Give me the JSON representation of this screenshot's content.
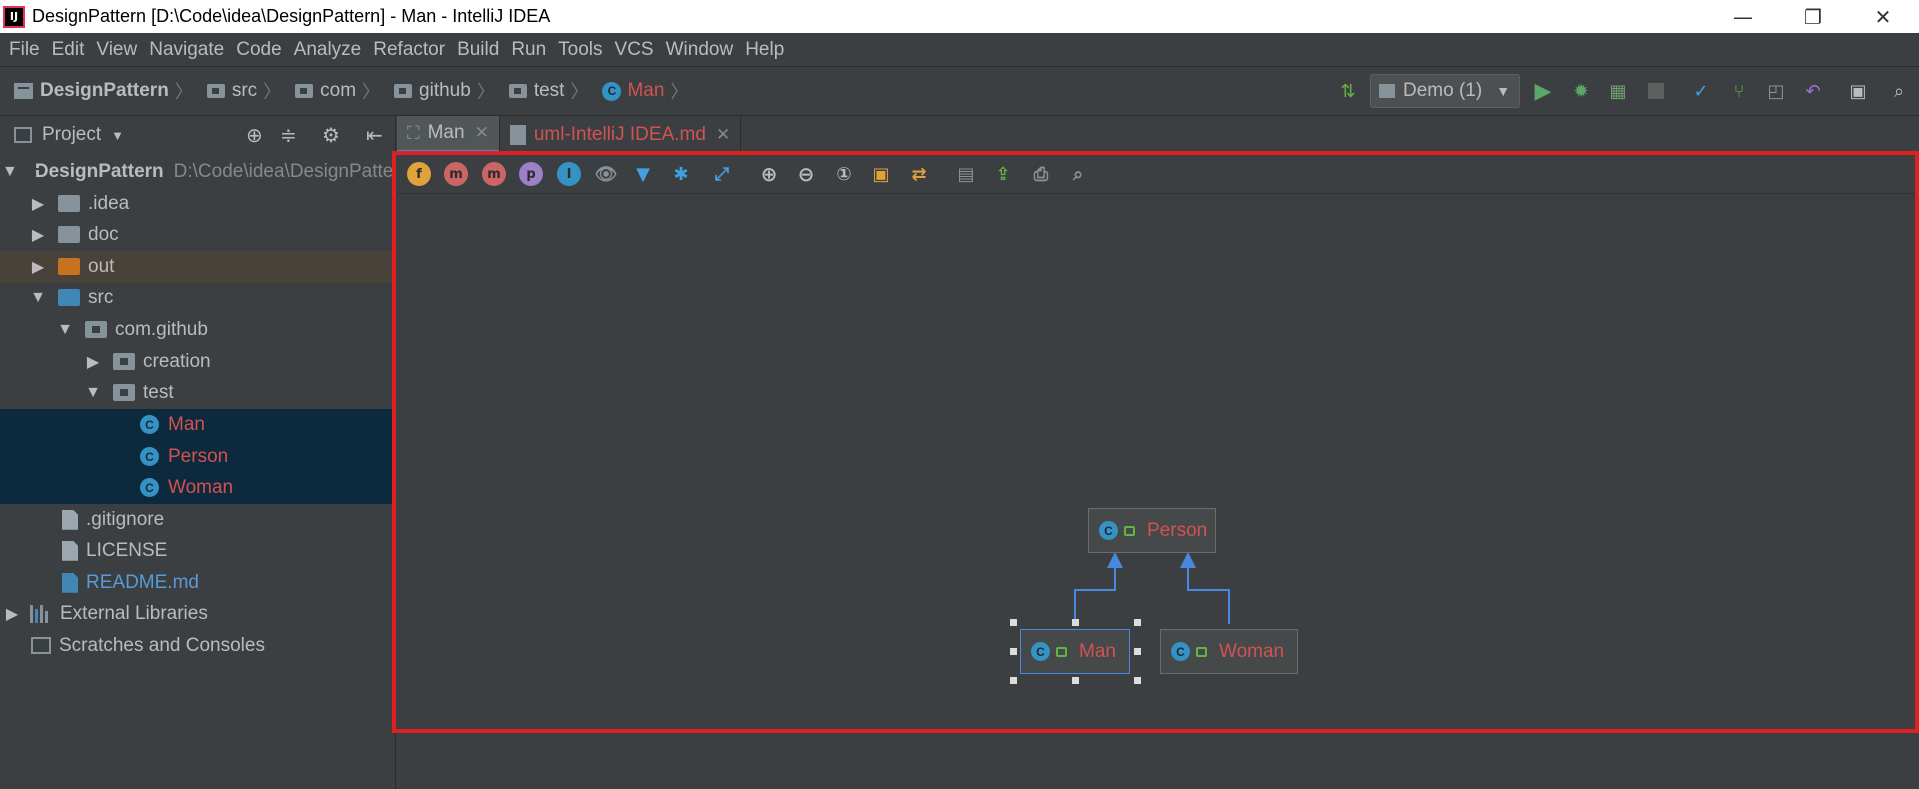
{
  "window": {
    "title": "DesignPattern [D:\\Code\\idea\\DesignPattern] - Man - IntelliJ IDEA",
    "logo_text": "IJ",
    "controls": {
      "minimize": "—",
      "restore": "❐",
      "close": "✕"
    }
  },
  "menu": {
    "items": [
      "File",
      "Edit",
      "View",
      "Navigate",
      "Code",
      "Analyze",
      "Refactor",
      "Build",
      "Run",
      "Tools",
      "VCS",
      "Window",
      "Help"
    ]
  },
  "breadcrumb": {
    "project": "DesignPattern",
    "items": [
      "src",
      "com",
      "github",
      "test"
    ],
    "current": "Man"
  },
  "run_config": {
    "label": "Demo (1)"
  },
  "project_panel": {
    "title": "Project",
    "tree": [
      {
        "label": "DesignPattern",
        "path": "D:\\Code\\idea\\DesignPattern",
        "type": "project",
        "expanded": true
      },
      {
        "label": ".idea",
        "type": "folder"
      },
      {
        "label": "doc",
        "type": "folder"
      },
      {
        "label": "out",
        "type": "folder-excluded"
      },
      {
        "label": "src",
        "type": "folder-source",
        "expanded": true
      },
      {
        "label": "com.github",
        "type": "package",
        "expanded": true
      },
      {
        "label": "creation",
        "type": "package"
      },
      {
        "label": "test",
        "type": "package",
        "expanded": true
      },
      {
        "label": "Man",
        "type": "class"
      },
      {
        "label": "Person",
        "type": "class"
      },
      {
        "label": "Woman",
        "type": "class"
      },
      {
        "label": ".gitignore",
        "type": "file"
      },
      {
        "label": "LICENSE",
        "type": "file"
      },
      {
        "label": "README.md",
        "type": "markdown"
      },
      {
        "label": "External Libraries",
        "type": "libraries"
      },
      {
        "label": "Scratches and Consoles",
        "type": "scratches"
      }
    ]
  },
  "editor_tabs": [
    {
      "label": "Man",
      "active": true,
      "icon": "diagram-icon"
    },
    {
      "label": "uml-IntelliJ IDEA.md",
      "active": false,
      "icon": "markdown-icon"
    }
  ],
  "uml_toolbar": {
    "buttons": [
      "f",
      "m",
      "m",
      "p",
      "I"
    ]
  },
  "uml_diagram": {
    "nodes": [
      {
        "label": "Person",
        "type": "class"
      },
      {
        "label": "Man",
        "type": "class",
        "selected": true
      },
      {
        "label": "Woman",
        "type": "class"
      }
    ],
    "edges": [
      {
        "from": "Man",
        "to": "Person",
        "kind": "inheritance"
      },
      {
        "from": "Woman",
        "to": "Person",
        "kind": "inheritance"
      }
    ]
  },
  "colors": {
    "class_name": "#d25252",
    "selection": "#0d293e",
    "highlight_outline": "#e02020",
    "edge": "#4a88e0"
  }
}
